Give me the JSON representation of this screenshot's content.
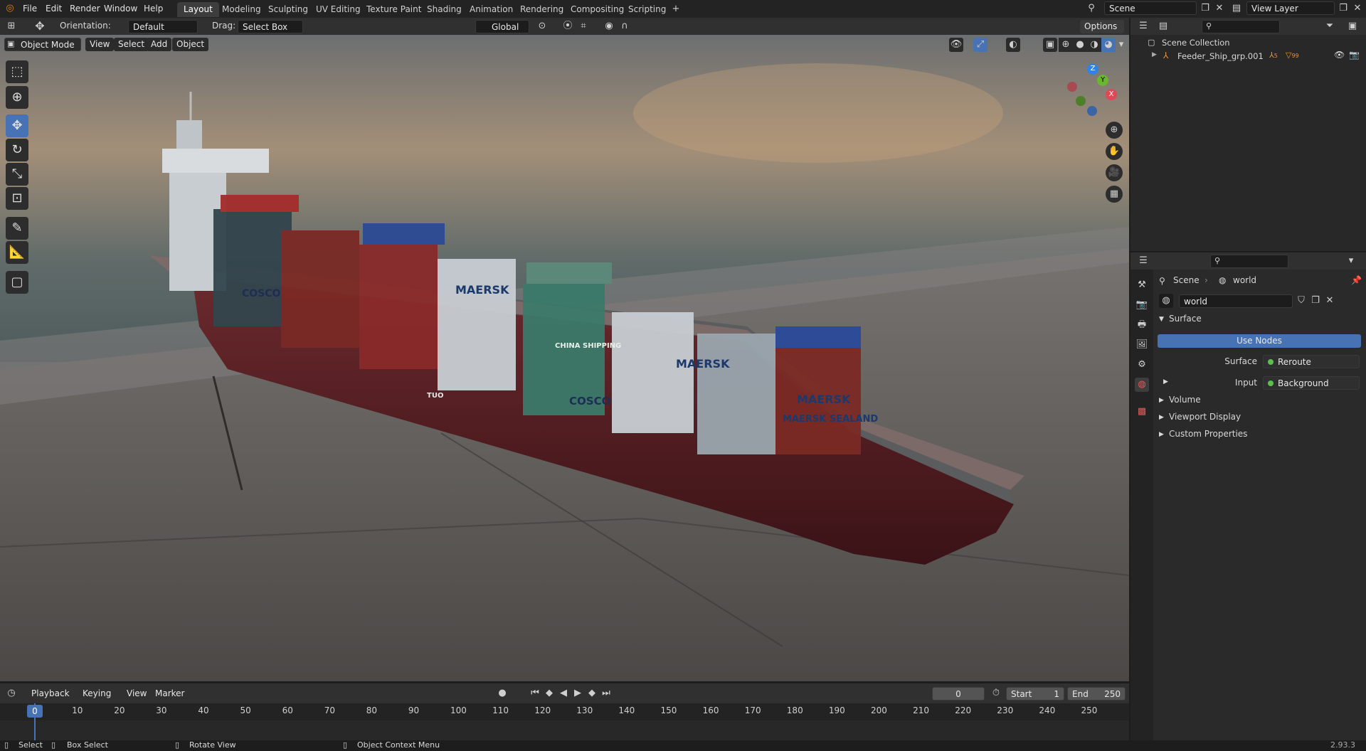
{
  "menu": [
    "File",
    "Edit",
    "Render",
    "Window",
    "Help"
  ],
  "workspaces": [
    "Layout",
    "Modeling",
    "Sculpting",
    "UV Editing",
    "Texture Paint",
    "Shading",
    "Animation",
    "Rendering",
    "Compositing",
    "Scripting"
  ],
  "scene_name": "Scene",
  "view_layer": "View Layer",
  "viewport_header": {
    "orientation_label": "Orientation:",
    "orientation_value": "Default",
    "drag_label": "Drag:",
    "drag_value": "Select Box",
    "transform_space": "Global",
    "options": "Options",
    "mode": "Object Mode",
    "menus": [
      "View",
      "Select",
      "Add",
      "Object"
    ]
  },
  "ship_labels": [
    "MAERSK",
    "MAERSK SEALAND",
    "COSCO",
    "CHINA SHIPPING",
    "TUO"
  ],
  "outliner": {
    "collection": "Scene Collection",
    "item": "Feeder_Ship_grp.001",
    "counts": [
      "5",
      "99"
    ]
  },
  "properties": {
    "breadcrumb_scene": "Scene",
    "breadcrumb_world": "world",
    "world_name": "world",
    "surface_header": "Surface",
    "use_nodes": "Use Nodes",
    "surface_label": "Surface",
    "surface_value": "Reroute",
    "input_label": "Input",
    "input_value": "Background",
    "panels": [
      "Volume",
      "Viewport Display",
      "Custom Properties"
    ]
  },
  "timeline": {
    "menus": [
      "Playback",
      "Keying",
      "View",
      "Marker"
    ],
    "current_frame": "0",
    "start_label": "Start",
    "start_value": "1",
    "end_label": "End",
    "end_value": "250",
    "ticks": [
      "0",
      "10",
      "20",
      "30",
      "40",
      "50",
      "60",
      "70",
      "80",
      "90",
      "100",
      "110",
      "120",
      "130",
      "140",
      "150",
      "160",
      "170",
      "180",
      "190",
      "200",
      "210",
      "220",
      "230",
      "240",
      "250"
    ]
  },
  "statusbar": {
    "items": [
      "Select",
      "Box Select",
      "Rotate View",
      "Object Context Menu"
    ],
    "version": "2.93.3"
  },
  "colors": {
    "accent": "#4772b3",
    "background": "#1d1d1d",
    "header": "#303030",
    "hull": "#5a1d22",
    "frame_marker": "#4772b3"
  }
}
